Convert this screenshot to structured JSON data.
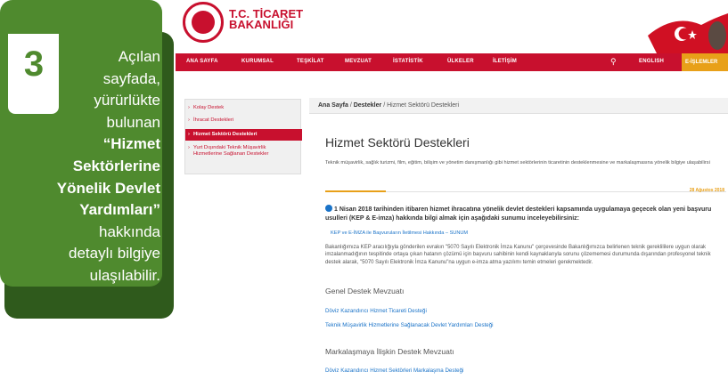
{
  "card": {
    "step_number": "3",
    "lines": [
      "Açılan",
      "sayfada,",
      "yürürlükte",
      "bulunan",
      "“Hizmet",
      "Sektörlerine",
      "Yönelik Devlet",
      "Yardımları”",
      "hakkında",
      "detaylı bilgiye",
      "ulaşılabilir."
    ]
  },
  "site": {
    "logo_line1": "T.C. TİCARET",
    "logo_line2": "BAKANLIĞI",
    "nav": [
      "ANA SAYFA",
      "KURUMSAL",
      "TEŞKİLAT",
      "MEVZUAT",
      "İSTATİSTİK",
      "ÜLKELER",
      "İLETİŞİM"
    ],
    "search_icon": "search-icon",
    "english": "ENGLISH",
    "eislemler": "E-İŞLEMLER",
    "side_menu": [
      "Kolay Destek",
      "İhracat Destekleri",
      "Hizmet Sektörü Destekleri",
      "Yurt Dışındaki Teknik Müşavirlik Hizmetlerine Sağlanan Destekler"
    ],
    "breadcrumb": {
      "home": "Ana Sayfa",
      "sep": "/",
      "parent": "Destekler",
      "current": "Hizmet Sektörü Destekleri"
    },
    "page_title": "Hizmet Sektörü Destekleri",
    "intro": "Teknik müşavirlik, sağlık turizmi, film, eğitim, bilişim ve yönetim danışmanlığı gibi hizmet sektörlerinin ticaretinin desteklenmesine ve markalaşmasına yönelik bilgiye ulaşabilirsi",
    "date": "28 Ağustos 2018",
    "headline": "1 Nisan 2018 tarihinden itibaren hizmet ihracatına yönelik devlet destekleri kapsamında uygulamaya geçecek olan yeni başvuru usulleri (KEP & E-imza) hakkında bilgi almak için aşağıdaki sunumu inceleyebilirsiniz:",
    "kep_link": "KEP ve E-İMZA ile Başvuruların İletilmesi Hakkında – SUNUM",
    "body": "Bakanlığımıza KEP aracılığıyla gönderilen evrakın \"5070 Sayılı Elektronik İmza Kanunu\" çerçevesinde Bakanlığımızca belirlenen teknik gereklililere uygun olarak imzalanmadığının tespitinde ortaya çıkan hatanın çözümü için başvuru sahibinin kendi kaynaklarıyla sorunu çözememesi durumunda dışarından profesyonel teknik destek alarak, \"5070 Sayılı Elektronik İmza Kanunu\"na uygun e-imza atma yazılımı temin etmeleri gerekmektedir.",
    "section1": "Genel Destek Mevzuatı",
    "links1": [
      "Döviz Kazandırıcı Hizmet Ticareti Desteği",
      "Teknik Müşavirlik Hizmetlerine Sağlanacak Devlet Yardımları Desteği"
    ],
    "section2": "Markalaşmaya İlişkin Destek Mevzuatı",
    "links2": [
      "Döviz Kazandırıcı Hizmet Sektörleri Markalaşma Desteği"
    ]
  }
}
